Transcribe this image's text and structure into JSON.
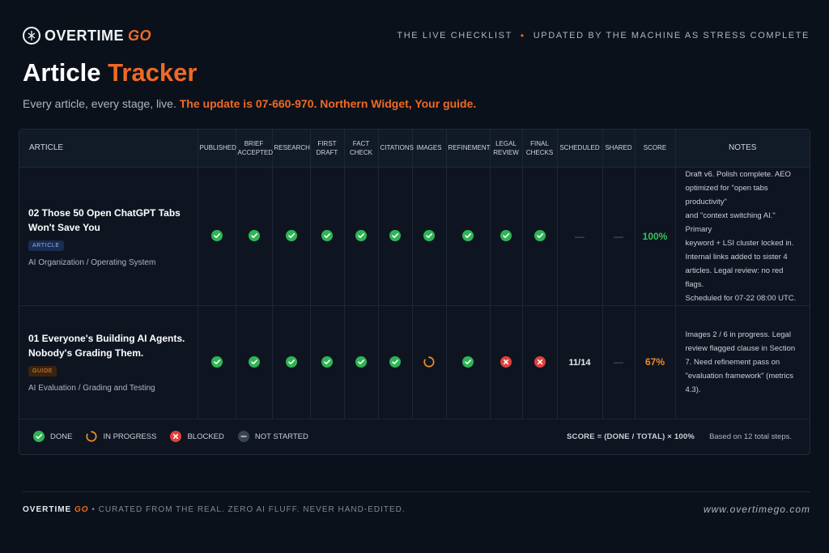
{
  "header": {
    "brand_word": "OVERTIME",
    "brand_go": "GO",
    "tagline_left": "THE LIVE CHECKLIST",
    "tagline_right": "UPDATED BY THE MACHINE AS STRESS COMPLETE"
  },
  "title": {
    "main": "Article",
    "accent": "Tracker"
  },
  "subtitle": {
    "text": "Every article, every stage, live.",
    "highlight": "The update is 07-660-970. Northern Widget, Your guide."
  },
  "table": {
    "headers": {
      "article": "ARTICLE",
      "published": "PUBLISHED",
      "brief_accepted": [
        "BRIEF",
        "ACCEPTED"
      ],
      "research": "RESEARCH",
      "first_draft": [
        "FIRST",
        "DRAFT"
      ],
      "fact_check": [
        "FACT",
        "CHECK"
      ],
      "citations": "CITATIONS",
      "images": "IMAGES",
      "refinement": "REFINEMENT",
      "legal_review": [
        "LEGAL",
        "REVIEW"
      ],
      "final_checks": [
        "FINAL",
        "CHECKS"
      ],
      "scheduled": "SCHEDULED",
      "shared": "SHARED",
      "score": "SCORE",
      "notes": "NOTES"
    },
    "rows": [
      {
        "title": "02 Those 50 Open ChatGPT Tabs Won't Save You",
        "badge": "ARTICLE",
        "path": "AI Organization / Operating System",
        "statuses": [
          "done",
          "done",
          "done",
          "done",
          "done",
          "done",
          "done",
          "done",
          "done",
          "done"
        ],
        "scheduled": "—",
        "shared": "—",
        "score": "100%",
        "notes": [
          "Draft v6. Polish complete. AEO",
          "optimized for \"open tabs productivity\"",
          "and \"context switching AI.\" Primary",
          "keyword + LSI cluster locked in.",
          "Internal links added to sister 4",
          "articles. Legal review: no red flags.",
          "Scheduled for 07-22 08:00 UTC."
        ]
      },
      {
        "title": "01 Everyone's Building AI Agents. Nobody's Grading Them.",
        "badge": "GUIDE",
        "path": "AI Evaluation / Grading and Testing",
        "statuses": [
          "done",
          "done",
          "done",
          "done",
          "done",
          "done",
          "in_progress",
          "done",
          "blocked",
          "blocked"
        ],
        "scheduled": "11/14",
        "shared": "—",
        "score": "67%",
        "notes": [
          "Images 2 / 6 in progress. Legal",
          "review flagged clause in Section",
          "7. Need refinement pass on",
          "\"evaluation framework\" (metrics 4.3)."
        ]
      }
    ]
  },
  "legend": {
    "done": "DONE",
    "in_progress": "IN PROGRESS",
    "blocked": "BLOCKED",
    "not_started": "NOT STARTED",
    "formula": "SCORE = (DONE / TOTAL) × 100%",
    "basis": "Based on 12 total steps."
  },
  "footer": {
    "brand_word": "OVERTIME",
    "brand_go": "GO",
    "text": "• CURATED FROM THE REAL. ZERO AI FLUFF. NEVER HAND-EDITED.",
    "url": "www.overtimego.com"
  },
  "colors": {
    "accent": "#ef6a24",
    "done": "#2fb455",
    "in_progress": "#ef8a2a",
    "blocked": "#e0413b",
    "not_started": "#5b6575",
    "score_full": "#35c25b",
    "score_partial": "#f08a2a"
  },
  "icons": {
    "done": "check-circle-icon",
    "in_progress": "progress-ring-icon",
    "blocked": "x-circle-icon",
    "not_started": "minus-circle-icon"
  }
}
